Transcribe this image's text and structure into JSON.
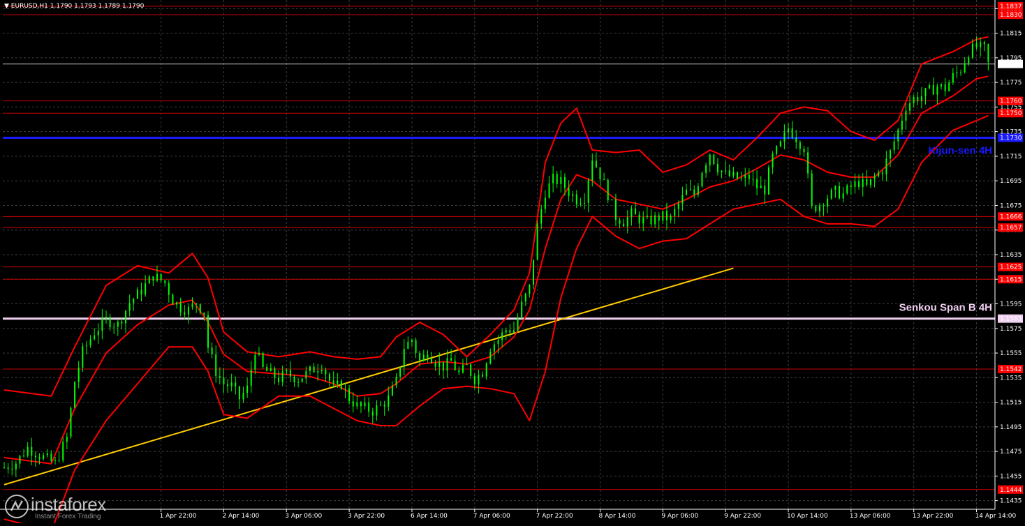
{
  "header": {
    "symbol_timeframe": "EURUSD,H1",
    "quote": "1.1790 1.1793 1.1789 1.1790"
  },
  "logo": {
    "wordmark": "instaforex",
    "tagline": "Instant Forex Trading"
  },
  "colors": {
    "background": "#000000",
    "grid": "#3c3c3c",
    "candles": "#00ff00",
    "bollinger": "#ff0000",
    "level_lines": "#cc0000",
    "kijun": "#1a1aff",
    "senkou": "#f0d0f0",
    "trendline": "#ffcc00",
    "price_line": "#c0c0c0"
  },
  "chart_data": {
    "type": "candlestick",
    "symbol": "EURUSD",
    "timeframe": "H1",
    "ylim": [
      1.1428,
      1.1842
    ],
    "y_ticks": [
      1.1435,
      1.1455,
      1.1475,
      1.1495,
      1.1515,
      1.1535,
      1.1555,
      1.1575,
      1.1595,
      1.1615,
      1.1635,
      1.1655,
      1.1675,
      1.1695,
      1.1715,
      1.1735,
      1.1755,
      1.1775,
      1.1795,
      1.1815,
      1.1835
    ],
    "y_tick_labels": [
      "1.1435",
      "1.1455",
      "1.1475",
      "1.1495",
      "1.1515",
      "1.1535",
      "1.1555",
      "1.1575",
      "1.1595",
      "1.1615",
      "1.1635",
      "1.1655",
      "1.1675",
      "1.1695",
      "1.1715",
      "1.1735",
      "1.1755",
      "1.1775",
      "1.1795",
      "1.1815",
      "1.1835"
    ],
    "x_ticks": [
      {
        "label": "1 Apr 22:00",
        "bar": 40
      },
      {
        "label": "2 Apr 14:00",
        "bar": 56
      },
      {
        "label": "3 Apr 06:00",
        "bar": 72
      },
      {
        "label": "3 Apr 22:00",
        "bar": 88
      },
      {
        "label": "6 Apr 14:00",
        "bar": 104
      },
      {
        "label": "7 Apr 06:00",
        "bar": 120
      },
      {
        "label": "7 Apr 22:00",
        "bar": 136
      },
      {
        "label": "8 Apr 14:00",
        "bar": 152
      },
      {
        "label": "9 Apr 06:00",
        "bar": 168
      },
      {
        "label": "9 Apr 22:00",
        "bar": 184
      },
      {
        "label": "10 Apr 14:00",
        "bar": 200
      },
      {
        "label": "13 Apr 06:00",
        "bar": 216
      },
      {
        "label": "13 Apr 22:00",
        "bar": 232
      },
      {
        "label": "14 Apr 14:00",
        "bar": 248
      }
    ],
    "bars_total": 252,
    "close_path": [
      [
        0,
        1.1462
      ],
      [
        3,
        1.1466
      ],
      [
        6,
        1.1478
      ],
      [
        9,
        1.1472
      ],
      [
        13,
        1.1465
      ],
      [
        16,
        1.1486
      ],
      [
        18,
        1.1532
      ],
      [
        20,
        1.1556
      ],
      [
        23,
        1.1572
      ],
      [
        26,
        1.1582
      ],
      [
        29,
        1.1578
      ],
      [
        32,
        1.1596
      ],
      [
        35,
        1.1606
      ],
      [
        38,
        1.1618
      ],
      [
        41,
        1.1612
      ],
      [
        43,
        1.1598
      ],
      [
        45,
        1.1592
      ],
      [
        47,
        1.159
      ],
      [
        49,
        1.1596
      ],
      [
        51,
        1.1588
      ],
      [
        52,
        1.156
      ],
      [
        54,
        1.154
      ],
      [
        56,
        1.153
      ],
      [
        58,
        1.1528
      ],
      [
        60,
        1.1518
      ],
      [
        62,
        1.1526
      ],
      [
        64,
        1.1558
      ],
      [
        66,
        1.1542
      ],
      [
        68,
        1.1538
      ],
      [
        70,
        1.1534
      ],
      [
        72,
        1.1538
      ],
      [
        75,
        1.1534
      ],
      [
        78,
        1.154
      ],
      [
        81,
        1.1546
      ],
      [
        84,
        1.1526
      ],
      [
        86,
        1.153
      ],
      [
        88,
        1.1518
      ],
      [
        90,
        1.1512
      ],
      [
        92,
        1.151
      ],
      [
        94,
        1.1508
      ],
      [
        96,
        1.1512
      ],
      [
        98,
        1.1518
      ],
      [
        100,
        1.1532
      ],
      [
        102,
        1.156
      ],
      [
        104,
        1.1566
      ],
      [
        106,
        1.1548
      ],
      [
        108,
        1.1556
      ],
      [
        110,
        1.1548
      ],
      [
        112,
        1.1544
      ],
      [
        114,
        1.1548
      ],
      [
        116,
        1.1538
      ],
      [
        118,
        1.1544
      ],
      [
        120,
        1.1534
      ],
      [
        122,
        1.154
      ],
      [
        124,
        1.156
      ],
      [
        126,
        1.1566
      ],
      [
        128,
        1.1574
      ],
      [
        130,
        1.1574
      ],
      [
        132,
        1.1594
      ],
      [
        134,
        1.1608
      ],
      [
        136,
        1.1658
      ],
      [
        138,
        1.1686
      ],
      [
        140,
        1.1696
      ],
      [
        142,
        1.1694
      ],
      [
        144,
        1.1686
      ],
      [
        146,
        1.168
      ],
      [
        148,
        1.1682
      ],
      [
        150,
        1.1714
      ],
      [
        152,
        1.17
      ],
      [
        154,
        1.1684
      ],
      [
        156,
        1.1666
      ],
      [
        158,
        1.1662
      ],
      [
        160,
        1.1668
      ],
      [
        162,
        1.1664
      ],
      [
        164,
        1.1662
      ],
      [
        166,
        1.1664
      ],
      [
        168,
        1.1666
      ],
      [
        170,
        1.1664
      ],
      [
        172,
        1.1676
      ],
      [
        174,
        1.1686
      ],
      [
        176,
        1.1684
      ],
      [
        178,
        1.1704
      ],
      [
        180,
        1.1718
      ],
      [
        182,
        1.1706
      ],
      [
        184,
        1.17
      ],
      [
        186,
        1.1698
      ],
      [
        188,
        1.1696
      ],
      [
        190,
        1.1698
      ],
      [
        192,
        1.169
      ],
      [
        194,
        1.1688
      ],
      [
        196,
        1.1714
      ],
      [
        198,
        1.1724
      ],
      [
        200,
        1.1738
      ],
      [
        202,
        1.173
      ],
      [
        204,
        1.1722
      ],
      [
        206,
        1.1672
      ],
      [
        208,
        1.1676
      ],
      [
        210,
        1.1682
      ],
      [
        212,
        1.1686
      ],
      [
        214,
        1.1684
      ],
      [
        216,
        1.169
      ],
      [
        218,
        1.1694
      ],
      [
        220,
        1.169
      ],
      [
        222,
        1.1698
      ],
      [
        224,
        1.1704
      ],
      [
        226,
        1.1718
      ],
      [
        228,
        1.1736
      ],
      [
        230,
        1.1756
      ],
      [
        232,
        1.1762
      ],
      [
        234,
        1.1764
      ],
      [
        236,
        1.1768
      ],
      [
        238,
        1.1772
      ],
      [
        240,
        1.177
      ],
      [
        242,
        1.178
      ],
      [
        244,
        1.1786
      ],
      [
        246,
        1.18
      ],
      [
        248,
        1.1804
      ],
      [
        250,
        1.1802
      ],
      [
        251,
        1.179
      ]
    ],
    "bollinger_upper": [
      [
        0,
        1.1525
      ],
      [
        12,
        1.152
      ],
      [
        18,
        1.156
      ],
      [
        26,
        1.161
      ],
      [
        34,
        1.1626
      ],
      [
        42,
        1.162
      ],
      [
        48,
        1.1636
      ],
      [
        52,
        1.1616
      ],
      [
        56,
        1.1572
      ],
      [
        62,
        1.1556
      ],
      [
        70,
        1.1552
      ],
      [
        78,
        1.1556
      ],
      [
        84,
        1.1552
      ],
      [
        90,
        1.155
      ],
      [
        96,
        1.1552
      ],
      [
        100,
        1.1568
      ],
      [
        106,
        1.158
      ],
      [
        112,
        1.157
      ],
      [
        118,
        1.1552
      ],
      [
        124,
        1.157
      ],
      [
        130,
        1.159
      ],
      [
        134,
        1.162
      ],
      [
        138,
        1.171
      ],
      [
        142,
        1.1742
      ],
      [
        146,
        1.1754
      ],
      [
        150,
        1.172
      ],
      [
        156,
        1.1718
      ],
      [
        162,
        1.172
      ],
      [
        168,
        1.1702
      ],
      [
        174,
        1.1708
      ],
      [
        180,
        1.172
      ],
      [
        186,
        1.1712
      ],
      [
        192,
        1.173
      ],
      [
        198,
        1.175
      ],
      [
        204,
        1.1755
      ],
      [
        210,
        1.1752
      ],
      [
        216,
        1.1735
      ],
      [
        222,
        1.1728
      ],
      [
        228,
        1.1744
      ],
      [
        234,
        1.179
      ],
      [
        242,
        1.18
      ],
      [
        248,
        1.181
      ],
      [
        251,
        1.1812
      ]
    ],
    "bollinger_middle": [
      [
        0,
        1.147
      ],
      [
        12,
        1.1465
      ],
      [
        18,
        1.151
      ],
      [
        26,
        1.1555
      ],
      [
        34,
        1.1578
      ],
      [
        42,
        1.1594
      ],
      [
        48,
        1.1598
      ],
      [
        52,
        1.158
      ],
      [
        56,
        1.1554
      ],
      [
        62,
        1.154
      ],
      [
        70,
        1.1538
      ],
      [
        78,
        1.1536
      ],
      [
        84,
        1.153
      ],
      [
        90,
        1.152
      ],
      [
        96,
        1.1522
      ],
      [
        100,
        1.153
      ],
      [
        106,
        1.1546
      ],
      [
        112,
        1.1548
      ],
      [
        118,
        1.1546
      ],
      [
        124,
        1.1552
      ],
      [
        130,
        1.1568
      ],
      [
        134,
        1.159
      ],
      [
        138,
        1.164
      ],
      [
        142,
        1.168
      ],
      [
        146,
        1.17
      ],
      [
        150,
        1.1695
      ],
      [
        156,
        1.168
      ],
      [
        162,
        1.1676
      ],
      [
        168,
        1.1672
      ],
      [
        174,
        1.168
      ],
      [
        180,
        1.169
      ],
      [
        186,
        1.1695
      ],
      [
        192,
        1.1705
      ],
      [
        198,
        1.1716
      ],
      [
        204,
        1.1712
      ],
      [
        210,
        1.1702
      ],
      [
        216,
        1.1698
      ],
      [
        222,
        1.1698
      ],
      [
        228,
        1.1716
      ],
      [
        234,
        1.175
      ],
      [
        242,
        1.1764
      ],
      [
        248,
        1.1778
      ],
      [
        251,
        1.178
      ]
    ],
    "bollinger_lower": [
      [
        0,
        1.142
      ],
      [
        12,
        1.141
      ],
      [
        18,
        1.146
      ],
      [
        26,
        1.15
      ],
      [
        34,
        1.153
      ],
      [
        42,
        1.156
      ],
      [
        48,
        1.156
      ],
      [
        52,
        1.154
      ],
      [
        56,
        1.1505
      ],
      [
        62,
        1.1502
      ],
      [
        70,
        1.152
      ],
      [
        78,
        1.152
      ],
      [
        84,
        1.151
      ],
      [
        90,
        1.15
      ],
      [
        96,
        1.1496
      ],
      [
        100,
        1.1496
      ],
      [
        106,
        1.1512
      ],
      [
        112,
        1.1526
      ],
      [
        118,
        1.1528
      ],
      [
        124,
        1.1526
      ],
      [
        130,
        1.1522
      ],
      [
        134,
        1.15
      ],
      [
        138,
        1.154
      ],
      [
        142,
        1.16
      ],
      [
        146,
        1.164
      ],
      [
        150,
        1.1666
      ],
      [
        156,
        1.165
      ],
      [
        162,
        1.164
      ],
      [
        168,
        1.1646
      ],
      [
        174,
        1.1648
      ],
      [
        180,
        1.166
      ],
      [
        186,
        1.1672
      ],
      [
        192,
        1.1676
      ],
      [
        198,
        1.168
      ],
      [
        204,
        1.1666
      ],
      [
        210,
        1.166
      ],
      [
        216,
        1.166
      ],
      [
        222,
        1.1658
      ],
      [
        228,
        1.1672
      ],
      [
        234,
        1.171
      ],
      [
        242,
        1.1736
      ],
      [
        248,
        1.1744
      ],
      [
        251,
        1.1748
      ]
    ],
    "trendline": {
      "from": [
        0,
        1.1448
      ],
      "to": [
        186,
        1.1624
      ]
    },
    "levels": [
      {
        "value": 1.1837,
        "label": "1.1837",
        "role": "resistance"
      },
      {
        "value": 1.183,
        "label": "1.1830",
        "role": "resistance"
      },
      {
        "value": 1.176,
        "label": "1.1760",
        "role": "resistance"
      },
      {
        "value": 1.175,
        "label": "1.1750",
        "role": "resistance"
      },
      {
        "value": 1.1666,
        "label": "1.1666",
        "role": "support"
      },
      {
        "value": 1.1657,
        "label": "1.1657",
        "role": "support"
      },
      {
        "value": 1.1625,
        "label": "1.1625",
        "role": "support"
      },
      {
        "value": 1.1615,
        "label": "1.1615",
        "role": "support"
      },
      {
        "value": 1.1542,
        "label": "1.1542",
        "role": "support"
      },
      {
        "value": 1.1444,
        "label": "1.1444",
        "role": "support"
      }
    ],
    "kijun_sen": {
      "value": 1.173,
      "label": "1.1730",
      "annotation": "Kijun-sen 4H"
    },
    "senkou_span_b": {
      "value": 1.1583,
      "label": "1.1583",
      "annotation": "Senkou Span B 4H"
    },
    "current_price": {
      "value": 1.179,
      "label": "1.1790"
    },
    "grid": true
  }
}
